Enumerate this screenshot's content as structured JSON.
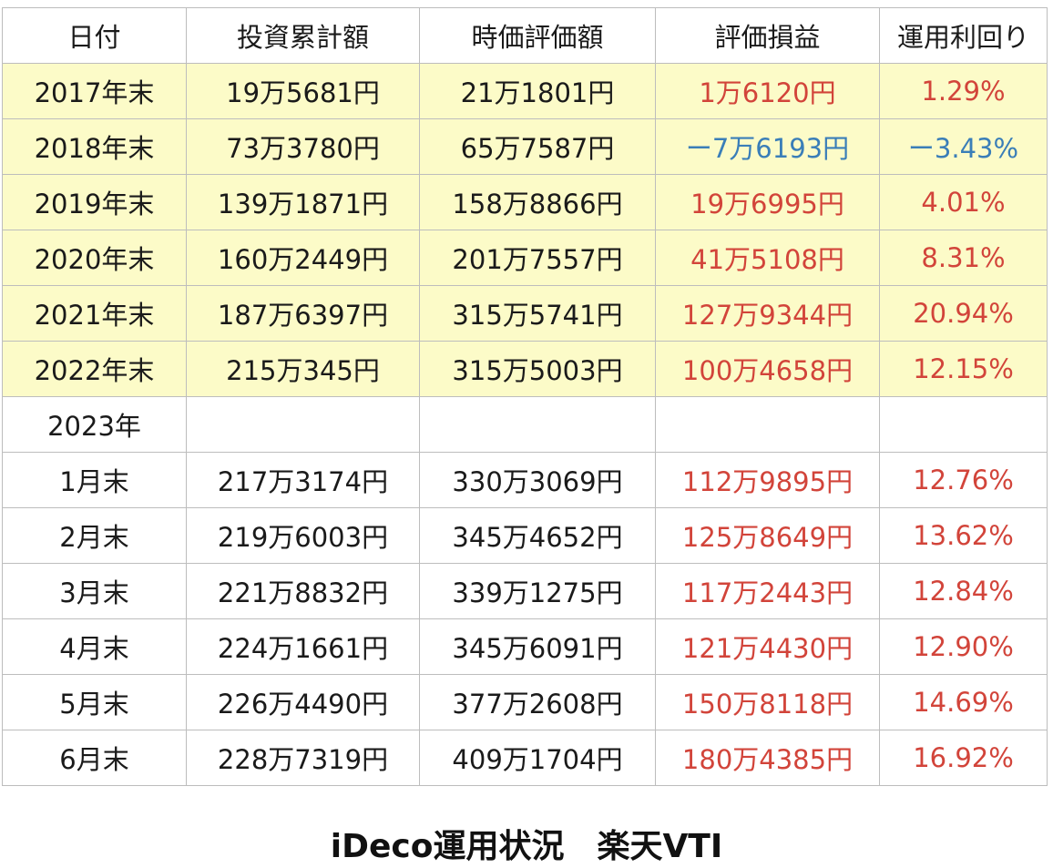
{
  "headers": [
    "日付",
    "投資累計額",
    "時価評価額",
    "評価損益",
    "運用利回り"
  ],
  "colors": {
    "highlight": "#fcfbc8",
    "gain": "#d2443a",
    "loss": "#3a7eb8"
  },
  "rows": [
    {
      "date": "2017年末",
      "invested": "19万5681円",
      "value": "21万1801円",
      "pl": "1万6120円",
      "ret": "1.29%",
      "highlight": true,
      "sign": "pos"
    },
    {
      "date": "2018年末",
      "invested": "73万3780円",
      "value": "65万7587円",
      "pl": "ー7万6193円",
      "ret": "ー3.43%",
      "highlight": true,
      "sign": "neg"
    },
    {
      "date": "2019年末",
      "invested": "139万1871円",
      "value": "158万8866円",
      "pl": "19万6995円",
      "ret": "4.01%",
      "highlight": true,
      "sign": "pos"
    },
    {
      "date": "2020年末",
      "invested": "160万2449円",
      "value": "201万7557円",
      "pl": "41万5108円",
      "ret": "8.31%",
      "highlight": true,
      "sign": "pos"
    },
    {
      "date": "2021年末",
      "invested": "187万6397円",
      "value": "315万5741円",
      "pl": "127万9344円",
      "ret": "20.94%",
      "highlight": true,
      "sign": "pos"
    },
    {
      "date": "2022年末",
      "invested": "215万345円",
      "value": "315万5003円",
      "pl": "100万4658円",
      "ret": "12.15%",
      "highlight": true,
      "sign": "pos"
    },
    {
      "date": "2023年",
      "invested": "",
      "value": "",
      "pl": "",
      "ret": "",
      "highlight": false,
      "sign": ""
    },
    {
      "date": "1月末",
      "invested": "217万3174円",
      "value": "330万3069円",
      "pl": "112万9895円",
      "ret": "12.76%",
      "highlight": false,
      "sign": "pos"
    },
    {
      "date": "2月末",
      "invested": "219万6003円",
      "value": "345万4652円",
      "pl": "125万8649円",
      "ret": "13.62%",
      "highlight": false,
      "sign": "pos"
    },
    {
      "date": "3月末",
      "invested": "221万8832円",
      "value": "339万1275円",
      "pl": "117万2443円",
      "ret": "12.84%",
      "highlight": false,
      "sign": "pos"
    },
    {
      "date": "4月末",
      "invested": "224万1661円",
      "value": "345万6091円",
      "pl": "121万4430円",
      "ret": "12.90%",
      "highlight": false,
      "sign": "pos"
    },
    {
      "date": "5月末",
      "invested": "226万4490円",
      "value": "377万2608円",
      "pl": "150万8118円",
      "ret": "14.69%",
      "highlight": false,
      "sign": "pos"
    },
    {
      "date": "6月末",
      "invested": "228万7319円",
      "value": "409万1704円",
      "pl": "180万4385円",
      "ret": "16.92%",
      "highlight": false,
      "sign": "pos"
    }
  ],
  "caption": "iDeco運用状況　楽天VTI"
}
